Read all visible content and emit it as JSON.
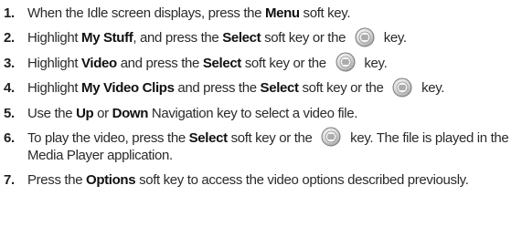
{
  "steps": [
    {
      "num": "1.",
      "parts": [
        {
          "t": "text",
          "v": "When the Idle screen displays, press the "
        },
        {
          "t": "bold",
          "v": "Menu"
        },
        {
          "t": "text",
          "v": " soft key."
        }
      ]
    },
    {
      "num": "2.",
      "parts": [
        {
          "t": "text",
          "v": "Highlight "
        },
        {
          "t": "bold",
          "v": "My Stuff"
        },
        {
          "t": "text",
          "v": ", and press the "
        },
        {
          "t": "bold",
          "v": "Select"
        },
        {
          "t": "text",
          "v": " soft key or the "
        },
        {
          "t": "icon",
          "v": "ok-key-icon"
        },
        {
          "t": "text",
          "v": " key."
        }
      ]
    },
    {
      "num": "3.",
      "parts": [
        {
          "t": "text",
          "v": "Highlight "
        },
        {
          "t": "bold",
          "v": "Video"
        },
        {
          "t": "text",
          "v": " and press the "
        },
        {
          "t": "bold",
          "v": "Select"
        },
        {
          "t": "text",
          "v": " soft key or the "
        },
        {
          "t": "icon",
          "v": "ok-key-icon"
        },
        {
          "t": "text",
          "v": " key."
        }
      ]
    },
    {
      "num": "4.",
      "parts": [
        {
          "t": "text",
          "v": "Highlight "
        },
        {
          "t": "bold",
          "v": "My Video Clips"
        },
        {
          "t": "text",
          "v": " and press the "
        },
        {
          "t": "bold",
          "v": "Select"
        },
        {
          "t": "text",
          "v": " soft key or the "
        },
        {
          "t": "icon",
          "v": "ok-key-icon"
        },
        {
          "t": "text",
          "v": " key."
        }
      ]
    },
    {
      "num": "5.",
      "parts": [
        {
          "t": "text",
          "v": "Use the "
        },
        {
          "t": "bold",
          "v": "Up"
        },
        {
          "t": "text",
          "v": " or "
        },
        {
          "t": "bold",
          "v": "Down"
        },
        {
          "t": "text",
          "v": " Navigation key to select a video file."
        }
      ]
    },
    {
      "num": "6.",
      "parts": [
        {
          "t": "text",
          "v": "To play the video, press the "
        },
        {
          "t": "bold",
          "v": "Select"
        },
        {
          "t": "text",
          "v": " soft key or the "
        },
        {
          "t": "icon",
          "v": "ok-key-icon"
        },
        {
          "t": "text",
          "v": " key. The file is played in the Media Player application."
        }
      ]
    },
    {
      "num": "7.",
      "parts": [
        {
          "t": "text",
          "v": "Press the "
        },
        {
          "t": "bold",
          "v": "Options"
        },
        {
          "t": "text",
          "v": " soft key to access the video options described previously."
        }
      ]
    }
  ]
}
